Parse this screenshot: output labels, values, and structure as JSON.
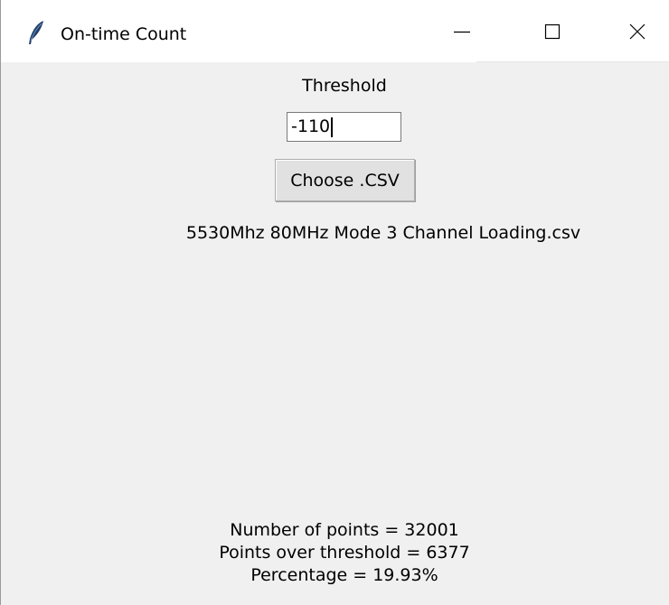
{
  "window": {
    "title": "On-time Count",
    "icon": "feather-icon",
    "controls": [
      "minimize-icon",
      "maximize-icon",
      "close-icon"
    ]
  },
  "form": {
    "threshold_label": "Threshold",
    "threshold_value": "-110",
    "choose_button_label": "Choose .CSV",
    "selected_file": "5530Mhz 80MHz Mode 3 Channel Loading.csv"
  },
  "results": {
    "number_of_points": "Number of points = 32001",
    "points_over_threshold": "Points over threshold = 6377",
    "percentage": "Percentage = 19.93%"
  }
}
